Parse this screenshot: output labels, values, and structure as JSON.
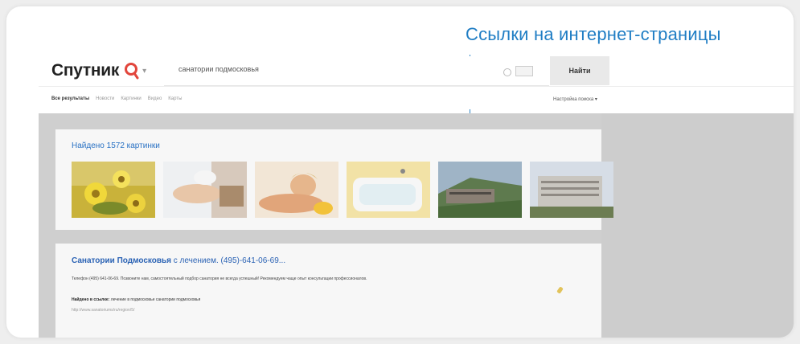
{
  "callout": {
    "label": "Ссылки на интернет-страницы"
  },
  "header": {
    "logo_text": "Спутник",
    "search_query": "санатории подмосковья",
    "search_button": "Найти",
    "tabs": [
      {
        "label": "Все результаты",
        "active": true
      },
      {
        "label": "Новости",
        "active": false
      },
      {
        "label": "Картинки",
        "active": false
      },
      {
        "label": "Видео",
        "active": false
      },
      {
        "label": "Карты",
        "active": false
      }
    ],
    "settings_label": "Настройка поиска ▾"
  },
  "images_panel": {
    "title": "Найдено 1572 картинки",
    "thumbnails": [
      "flowers",
      "massage-hands",
      "spa-woman",
      "bath-tub",
      "hillside-building",
      "sanatorium-building"
    ]
  },
  "result": {
    "title_bold": "Санатории Подмосковья",
    "title_rest": " с лечением. (495)-641-06-69...",
    "snippet": "Телефон (495) 641-06-69. Позвоните нам, самостоятельный подбор санатория не всегда успешный! Рекомендуем чаще опыт консультации профессионалов.",
    "found_prefix": "Найдено в ссылке:",
    "found_text": " лечение в подмосковье санатории подмосковья",
    "url": "http://www.sanatoriums/ru/region/5/"
  },
  "colors": {
    "accent": "#1f7dc4",
    "logo_red": "#e2463c",
    "link": "#2a72c4"
  }
}
